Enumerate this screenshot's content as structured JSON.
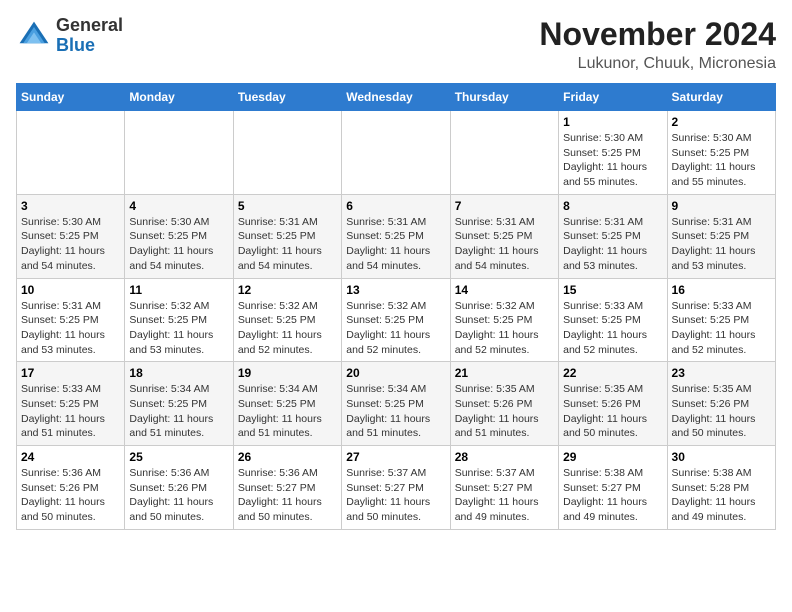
{
  "header": {
    "logo": {
      "general": "General",
      "blue": "Blue"
    },
    "title": "November 2024",
    "location": "Lukunor, Chuuk, Micronesia"
  },
  "weekdays": [
    "Sunday",
    "Monday",
    "Tuesday",
    "Wednesday",
    "Thursday",
    "Friday",
    "Saturday"
  ],
  "weeks": [
    [
      {
        "day": "",
        "info": ""
      },
      {
        "day": "",
        "info": ""
      },
      {
        "day": "",
        "info": ""
      },
      {
        "day": "",
        "info": ""
      },
      {
        "day": "",
        "info": ""
      },
      {
        "day": "1",
        "info": "Sunrise: 5:30 AM\nSunset: 5:25 PM\nDaylight: 11 hours and 55 minutes."
      },
      {
        "day": "2",
        "info": "Sunrise: 5:30 AM\nSunset: 5:25 PM\nDaylight: 11 hours and 55 minutes."
      }
    ],
    [
      {
        "day": "3",
        "info": "Sunrise: 5:30 AM\nSunset: 5:25 PM\nDaylight: 11 hours and 54 minutes."
      },
      {
        "day": "4",
        "info": "Sunrise: 5:30 AM\nSunset: 5:25 PM\nDaylight: 11 hours and 54 minutes."
      },
      {
        "day": "5",
        "info": "Sunrise: 5:31 AM\nSunset: 5:25 PM\nDaylight: 11 hours and 54 minutes."
      },
      {
        "day": "6",
        "info": "Sunrise: 5:31 AM\nSunset: 5:25 PM\nDaylight: 11 hours and 54 minutes."
      },
      {
        "day": "7",
        "info": "Sunrise: 5:31 AM\nSunset: 5:25 PM\nDaylight: 11 hours and 54 minutes."
      },
      {
        "day": "8",
        "info": "Sunrise: 5:31 AM\nSunset: 5:25 PM\nDaylight: 11 hours and 53 minutes."
      },
      {
        "day": "9",
        "info": "Sunrise: 5:31 AM\nSunset: 5:25 PM\nDaylight: 11 hours and 53 minutes."
      }
    ],
    [
      {
        "day": "10",
        "info": "Sunrise: 5:31 AM\nSunset: 5:25 PM\nDaylight: 11 hours and 53 minutes."
      },
      {
        "day": "11",
        "info": "Sunrise: 5:32 AM\nSunset: 5:25 PM\nDaylight: 11 hours and 53 minutes."
      },
      {
        "day": "12",
        "info": "Sunrise: 5:32 AM\nSunset: 5:25 PM\nDaylight: 11 hours and 52 minutes."
      },
      {
        "day": "13",
        "info": "Sunrise: 5:32 AM\nSunset: 5:25 PM\nDaylight: 11 hours and 52 minutes."
      },
      {
        "day": "14",
        "info": "Sunrise: 5:32 AM\nSunset: 5:25 PM\nDaylight: 11 hours and 52 minutes."
      },
      {
        "day": "15",
        "info": "Sunrise: 5:33 AM\nSunset: 5:25 PM\nDaylight: 11 hours and 52 minutes."
      },
      {
        "day": "16",
        "info": "Sunrise: 5:33 AM\nSunset: 5:25 PM\nDaylight: 11 hours and 52 minutes."
      }
    ],
    [
      {
        "day": "17",
        "info": "Sunrise: 5:33 AM\nSunset: 5:25 PM\nDaylight: 11 hours and 51 minutes."
      },
      {
        "day": "18",
        "info": "Sunrise: 5:34 AM\nSunset: 5:25 PM\nDaylight: 11 hours and 51 minutes."
      },
      {
        "day": "19",
        "info": "Sunrise: 5:34 AM\nSunset: 5:25 PM\nDaylight: 11 hours and 51 minutes."
      },
      {
        "day": "20",
        "info": "Sunrise: 5:34 AM\nSunset: 5:25 PM\nDaylight: 11 hours and 51 minutes."
      },
      {
        "day": "21",
        "info": "Sunrise: 5:35 AM\nSunset: 5:26 PM\nDaylight: 11 hours and 51 minutes."
      },
      {
        "day": "22",
        "info": "Sunrise: 5:35 AM\nSunset: 5:26 PM\nDaylight: 11 hours and 50 minutes."
      },
      {
        "day": "23",
        "info": "Sunrise: 5:35 AM\nSunset: 5:26 PM\nDaylight: 11 hours and 50 minutes."
      }
    ],
    [
      {
        "day": "24",
        "info": "Sunrise: 5:36 AM\nSunset: 5:26 PM\nDaylight: 11 hours and 50 minutes."
      },
      {
        "day": "25",
        "info": "Sunrise: 5:36 AM\nSunset: 5:26 PM\nDaylight: 11 hours and 50 minutes."
      },
      {
        "day": "26",
        "info": "Sunrise: 5:36 AM\nSunset: 5:27 PM\nDaylight: 11 hours and 50 minutes."
      },
      {
        "day": "27",
        "info": "Sunrise: 5:37 AM\nSunset: 5:27 PM\nDaylight: 11 hours and 50 minutes."
      },
      {
        "day": "28",
        "info": "Sunrise: 5:37 AM\nSunset: 5:27 PM\nDaylight: 11 hours and 49 minutes."
      },
      {
        "day": "29",
        "info": "Sunrise: 5:38 AM\nSunset: 5:27 PM\nDaylight: 11 hours and 49 minutes."
      },
      {
        "day": "30",
        "info": "Sunrise: 5:38 AM\nSunset: 5:28 PM\nDaylight: 11 hours and 49 minutes."
      }
    ]
  ]
}
